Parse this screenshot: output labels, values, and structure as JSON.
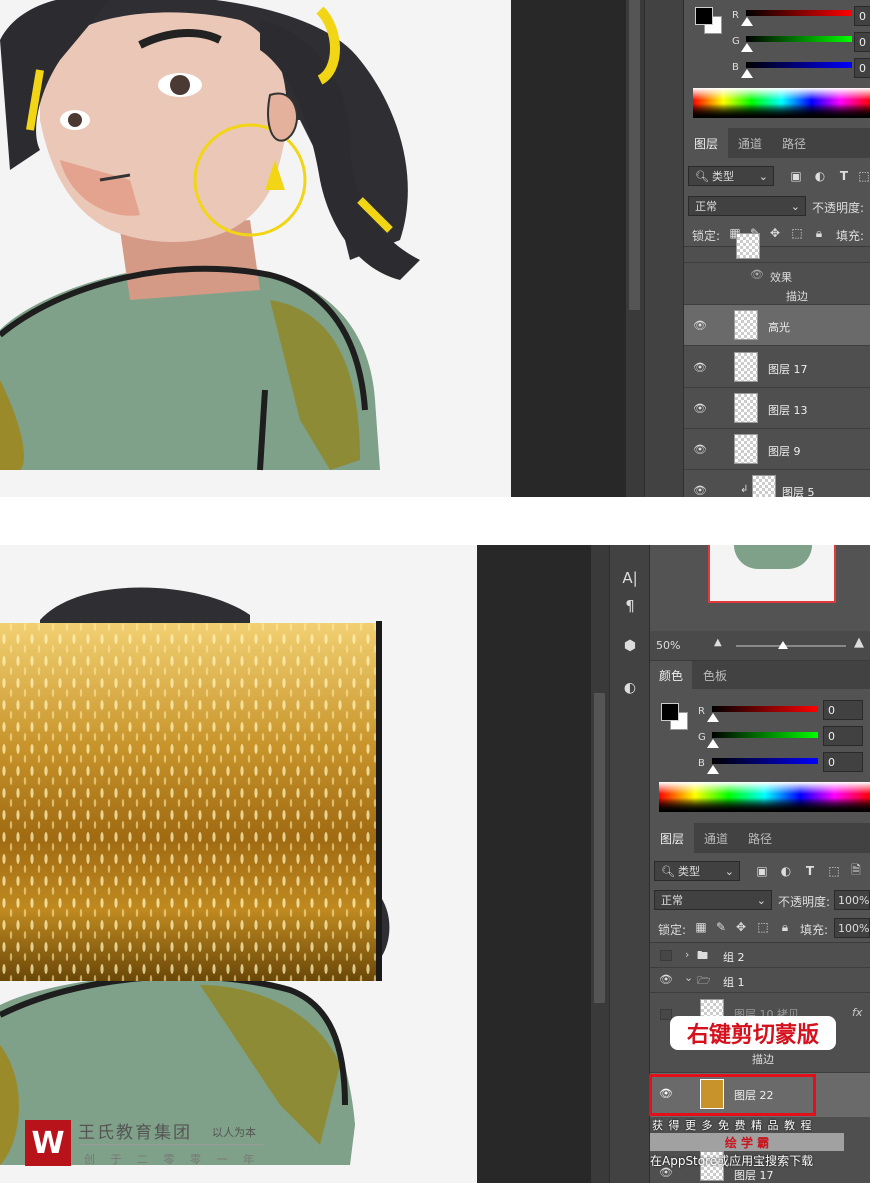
{
  "top": {
    "color_channels": [
      {
        "label": "R",
        "value": "0",
        "color": "#ff0000"
      },
      {
        "label": "G",
        "value": "0",
        "color": "#00ff00"
      },
      {
        "label": "B",
        "value": "0",
        "color": "#0000ff"
      }
    ],
    "layer_tabs": [
      "图层",
      "通道",
      "路径"
    ],
    "kind_filter": "类型",
    "blend_mode": "正常",
    "opacity_label": "不透明度:",
    "lock_label": "锁定:",
    "fill_label": "填充:",
    "effects_label": "效果",
    "stroke_label": "描边",
    "layers": [
      {
        "name": "高光",
        "selected": true
      },
      {
        "name": "图层 17",
        "selected": false
      },
      {
        "name": "图层 13",
        "selected": false
      },
      {
        "name": "图层 9",
        "selected": false
      },
      {
        "name": "图层 5",
        "selected": false
      }
    ]
  },
  "bottom": {
    "tools": [
      "A|",
      "¶"
    ],
    "zoom": "50%",
    "color_tabs": [
      "颜色",
      "色板"
    ],
    "color_channels": [
      {
        "label": "R",
        "value": "0",
        "color": "#ff0000"
      },
      {
        "label": "G",
        "value": "0",
        "color": "#00ff00"
      },
      {
        "label": "B",
        "value": "0",
        "color": "#0000ff"
      }
    ],
    "layer_tabs": [
      "图层",
      "通道",
      "路径"
    ],
    "kind_filter": "类型",
    "blend_mode": "正常",
    "opacity_label": "不透明度:",
    "opacity_value": "100%",
    "lock_label": "锁定:",
    "fill_label": "填充:",
    "fill_value": "100%",
    "groups": [
      {
        "name": "组 2",
        "expanded": false
      },
      {
        "name": "组 1",
        "expanded": true
      }
    ],
    "layer_partial": "图层 10 拷贝",
    "fx_label": "fx",
    "stroke_label": "描边",
    "selected_layer": "图层 22",
    "layer_bottom": "图层 17",
    "annotation": "右键剪切蒙版"
  },
  "watermark": {
    "company": "王氏教育集团",
    "slogan": "以人为本",
    "founded": "创 于 二 零 零 一 年"
  },
  "promo": {
    "line1": "获 得 更 多 免 费 精 品 教 程",
    "app_name": "绘 学 霸",
    "line2": "在AppStore或应用宝搜索下载"
  }
}
